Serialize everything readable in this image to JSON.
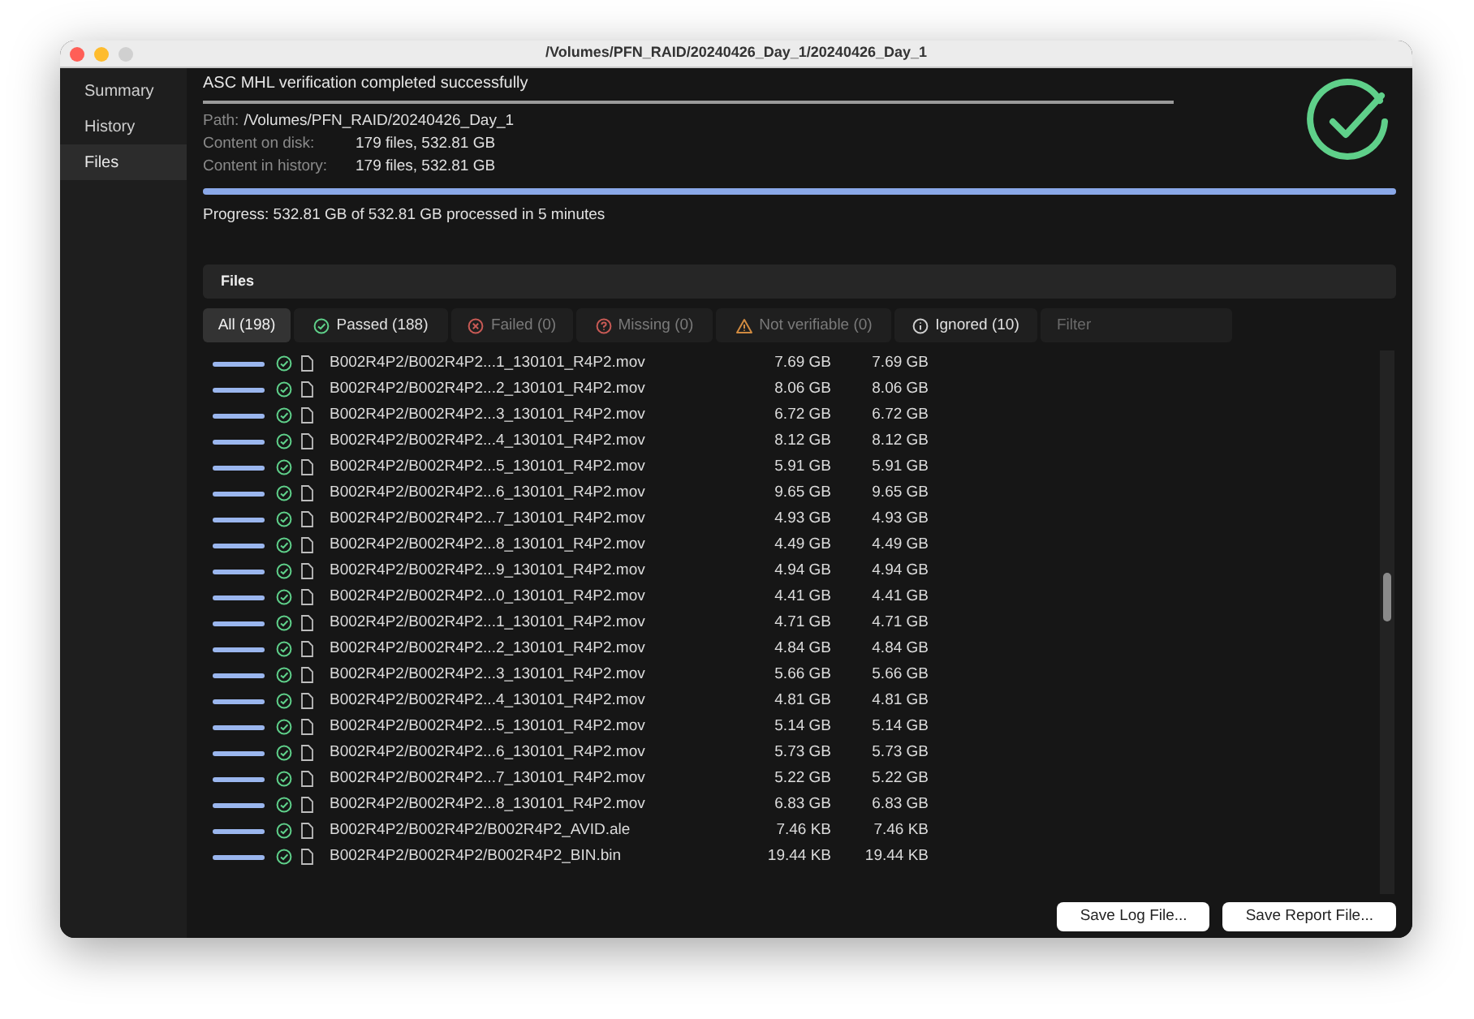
{
  "window": {
    "title": "/Volumes/PFN_RAID/20240426_Day_1/20240426_Day_1"
  },
  "sidebar": {
    "items": [
      {
        "label": "Summary",
        "selected": false
      },
      {
        "label": "History",
        "selected": false
      },
      {
        "label": "Files",
        "selected": true
      }
    ]
  },
  "summary": {
    "heading": "ASC MHL verification completed successfully",
    "path_label": "Path:",
    "path": "/Volumes/PFN_RAID/20240426_Day_1",
    "disk_label": "Content on disk:",
    "disk": "179 files, 532.81 GB",
    "history_label": "Content in history:",
    "history": "179 files, 532.81 GB",
    "progress": {
      "level": 1
    },
    "progress_text": "Progress: 532.81 GB of 532.81 GB processed in 5 minutes"
  },
  "files": {
    "title": "Files",
    "tabs": [
      {
        "kind": "all",
        "label": "All (198)",
        "selected": true
      },
      {
        "kind": "passed",
        "label": "Passed (188)",
        "selected": false
      },
      {
        "kind": "failed",
        "label": "Failed (0)",
        "selected": false
      },
      {
        "kind": "missing",
        "label": "Missing (0)",
        "selected": false
      },
      {
        "kind": "unverifiable",
        "label": "Not verifiable (0)",
        "selected": false
      },
      {
        "kind": "ignored",
        "label": "Ignored (10)",
        "selected": false
      }
    ],
    "filter": {
      "placeholder": "Filter"
    },
    "rows": [
      {
        "level": 1,
        "name": "B002R4P2/B002R4P2...1_130101_R4P2.mov",
        "size_on_disk": "7.69 GB",
        "size_in_history": "7.69 GB"
      },
      {
        "level": 1,
        "name": "B002R4P2/B002R4P2...2_130101_R4P2.mov",
        "size_on_disk": "8.06 GB",
        "size_in_history": "8.06 GB"
      },
      {
        "level": 1,
        "name": "B002R4P2/B002R4P2...3_130101_R4P2.mov",
        "size_on_disk": "6.72 GB",
        "size_in_history": "6.72 GB"
      },
      {
        "level": 1,
        "name": "B002R4P2/B002R4P2...4_130101_R4P2.mov",
        "size_on_disk": "8.12 GB",
        "size_in_history": "8.12 GB"
      },
      {
        "level": 1,
        "name": "B002R4P2/B002R4P2...5_130101_R4P2.mov",
        "size_on_disk": "5.91 GB",
        "size_in_history": "5.91 GB"
      },
      {
        "level": 1,
        "name": "B002R4P2/B002R4P2...6_130101_R4P2.mov",
        "size_on_disk": "9.65 GB",
        "size_in_history": "9.65 GB"
      },
      {
        "level": 1,
        "name": "B002R4P2/B002R4P2...7_130101_R4P2.mov",
        "size_on_disk": "4.93 GB",
        "size_in_history": "4.93 GB"
      },
      {
        "level": 1,
        "name": "B002R4P2/B002R4P2...8_130101_R4P2.mov",
        "size_on_disk": "4.49 GB",
        "size_in_history": "4.49 GB"
      },
      {
        "level": 1,
        "name": "B002R4P2/B002R4P2...9_130101_R4P2.mov",
        "size_on_disk": "4.94 GB",
        "size_in_history": "4.94 GB"
      },
      {
        "level": 1,
        "name": "B002R4P2/B002R4P2...0_130101_R4P2.mov",
        "size_on_disk": "4.41 GB",
        "size_in_history": "4.41 GB"
      },
      {
        "level": 1,
        "name": "B002R4P2/B002R4P2...1_130101_R4P2.mov",
        "size_on_disk": "4.71 GB",
        "size_in_history": "4.71 GB"
      },
      {
        "level": 1,
        "name": "B002R4P2/B002R4P2...2_130101_R4P2.mov",
        "size_on_disk": "4.84 GB",
        "size_in_history": "4.84 GB"
      },
      {
        "level": 1,
        "name": "B002R4P2/B002R4P2...3_130101_R4P2.mov",
        "size_on_disk": "5.66 GB",
        "size_in_history": "5.66 GB"
      },
      {
        "level": 1,
        "name": "B002R4P2/B002R4P2...4_130101_R4P2.mov",
        "size_on_disk": "4.81 GB",
        "size_in_history": "4.81 GB"
      },
      {
        "level": 1,
        "name": "B002R4P2/B002R4P2...5_130101_R4P2.mov",
        "size_on_disk": "5.14 GB",
        "size_in_history": "5.14 GB"
      },
      {
        "level": 1,
        "name": "B002R4P2/B002R4P2...6_130101_R4P2.mov",
        "size_on_disk": "5.73 GB",
        "size_in_history": "5.73 GB"
      },
      {
        "level": 1,
        "name": "B002R4P2/B002R4P2...7_130101_R4P2.mov",
        "size_on_disk": "5.22 GB",
        "size_in_history": "5.22 GB"
      },
      {
        "level": 1,
        "name": "B002R4P2/B002R4P2...8_130101_R4P2.mov",
        "size_on_disk": "6.83 GB",
        "size_in_history": "6.83 GB"
      },
      {
        "level": 1,
        "name": "B002R4P2/B002R4P2/B002R4P2_AVID.ale",
        "size_on_disk": "7.46 KB",
        "size_in_history": "7.46 KB"
      },
      {
        "level": 1,
        "name": "B002R4P2/B002R4P2/B002R4P2_BIN.bin",
        "size_on_disk": "19.44 KB",
        "size_in_history": "19.44 KB"
      }
    ]
  },
  "buttons": [
    {
      "label": "Save Log File..."
    },
    {
      "label": "Save Report File..."
    }
  ]
}
